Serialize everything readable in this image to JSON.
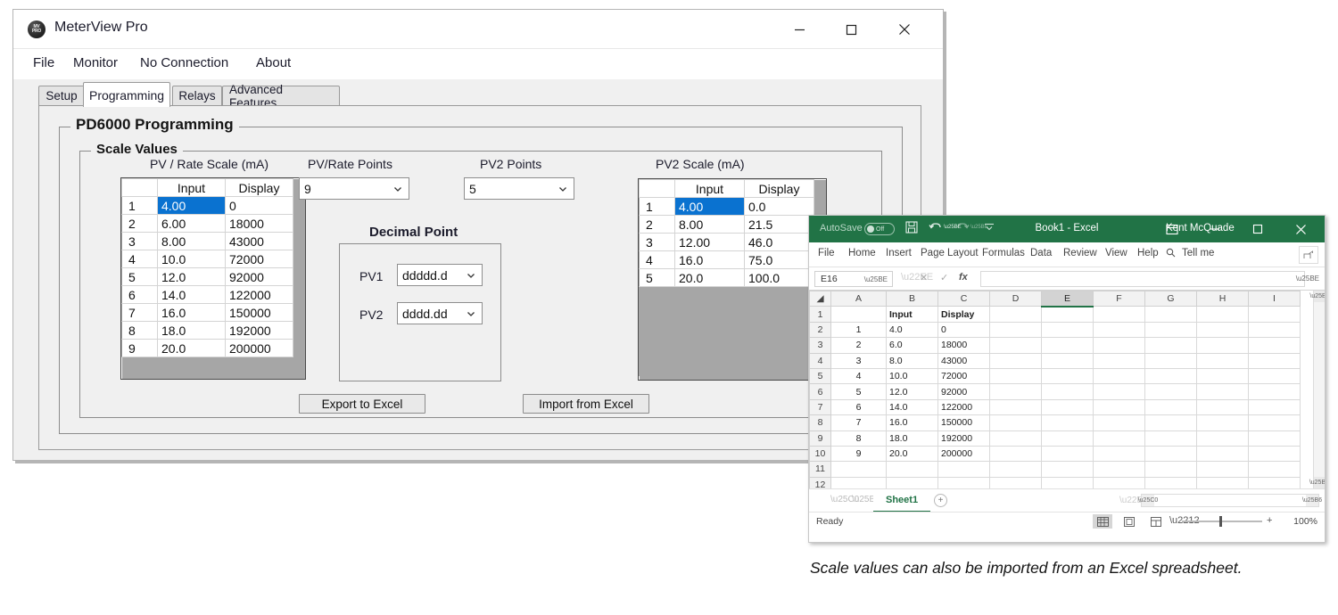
{
  "app_window": {
    "title": "MeterView Pro",
    "icon": "app-logo-icon",
    "window_controls": {
      "minimize": "–",
      "maximize": "☐",
      "close": "✕"
    },
    "menu": [
      {
        "label": "File"
      },
      {
        "label": "Monitor"
      },
      {
        "label": "No Connection"
      },
      {
        "label": "About"
      }
    ],
    "tabs": [
      {
        "label": "Setup",
        "active": false
      },
      {
        "label": "Programming",
        "active": true
      },
      {
        "label": "Relays",
        "active": false
      },
      {
        "label": "Advanced Features",
        "active": false
      }
    ],
    "groups": {
      "outer_title": "PD6000 Programming",
      "inner_title": "Scale Values"
    },
    "pv_rate_scale": {
      "caption": "PV / Rate Scale (mA)",
      "headers": [
        "",
        "Input",
        "Display"
      ],
      "rows": [
        {
          "n": "1",
          "input": "4.00",
          "display": "0",
          "selected": true
        },
        {
          "n": "2",
          "input": "6.00",
          "display": "18000",
          "selected": false
        },
        {
          "n": "3",
          "input": "8.00",
          "display": "43000",
          "selected": false
        },
        {
          "n": "4",
          "input": "10.0",
          "display": "72000",
          "selected": false
        },
        {
          "n": "5",
          "input": "12.0",
          "display": "92000",
          "selected": false
        },
        {
          "n": "6",
          "input": "14.0",
          "display": "122000",
          "selected": false
        },
        {
          "n": "7",
          "input": "16.0",
          "display": "150000",
          "selected": false
        },
        {
          "n": "8",
          "input": "18.0",
          "display": "192000",
          "selected": false
        },
        {
          "n": "9",
          "input": "20.0",
          "display": "200000",
          "selected": false
        }
      ]
    },
    "pv_rate_points": {
      "label": "PV/Rate Points",
      "value": "9"
    },
    "pv2_points": {
      "label": "PV2 Points",
      "value": "5"
    },
    "decimal_point": {
      "title": "Decimal Point",
      "pv1_label": "PV1",
      "pv1_value": "ddddd.d",
      "pv2_label": "PV2",
      "pv2_value": "dddd.dd"
    },
    "pv2_scale": {
      "caption": "PV2 Scale (mA)",
      "headers": [
        "",
        "Input",
        "Display"
      ],
      "rows": [
        {
          "n": "1",
          "input": "4.00",
          "display": "0.0",
          "selected": true
        },
        {
          "n": "2",
          "input": "8.00",
          "display": "21.5",
          "selected": false
        },
        {
          "n": "3",
          "input": "12.00",
          "display": "46.0",
          "selected": false
        },
        {
          "n": "4",
          "input": "16.0",
          "display": "75.0",
          "selected": false
        },
        {
          "n": "5",
          "input": "20.0",
          "display": "100.0",
          "selected": false
        }
      ],
      "empty_rows": 5
    },
    "buttons": {
      "export": "Export to Excel",
      "import": "Import from Excel"
    }
  },
  "excel_window": {
    "autosave_label": "AutoSave",
    "autosave_state": "Off",
    "quick_access": [
      "save-icon",
      "undo-icon",
      "redo-icon",
      "customize-icon"
    ],
    "document_title": "Book1  -  Excel",
    "user": "Kent McQuade",
    "window_controls": {
      "ribbon_display": "⊞",
      "minimize": "–",
      "maximize": "☐",
      "close": "✕"
    },
    "ribbon_tabs": [
      "File",
      "Home",
      "Insert",
      "Page Layout",
      "Formulas",
      "Data",
      "Review",
      "View",
      "Help"
    ],
    "tell_me": "Tell me",
    "share_icon": "share-icon",
    "name_box": "E16",
    "formula_bar": "",
    "formula_icons": {
      "cancel": "✕",
      "enter": "✓",
      "fx": "fx"
    },
    "columns": [
      "A",
      "B",
      "C",
      "D",
      "E",
      "F",
      "G",
      "H",
      "I"
    ],
    "active_column": "E",
    "rows": [
      {
        "r": "1",
        "cells": [
          "",
          "Input",
          "Display",
          "",
          "",
          "",
          "",
          "",
          ""
        ],
        "bold": true
      },
      {
        "r": "2",
        "cells": [
          "1",
          "4.0",
          "0",
          "",
          "",
          "",
          "",
          "",
          ""
        ],
        "bold": false
      },
      {
        "r": "3",
        "cells": [
          "2",
          "6.0",
          "18000",
          "",
          "",
          "",
          "",
          "",
          ""
        ],
        "bold": false
      },
      {
        "r": "4",
        "cells": [
          "3",
          "8.0",
          "43000",
          "",
          "",
          "",
          "",
          "",
          ""
        ],
        "bold": false
      },
      {
        "r": "5",
        "cells": [
          "4",
          "10.0",
          "72000",
          "",
          "",
          "",
          "",
          "",
          ""
        ],
        "bold": false
      },
      {
        "r": "6",
        "cells": [
          "5",
          "12.0",
          "92000",
          "",
          "",
          "",
          "",
          "",
          ""
        ],
        "bold": false
      },
      {
        "r": "7",
        "cells": [
          "6",
          "14.0",
          "122000",
          "",
          "",
          "",
          "",
          "",
          ""
        ],
        "bold": false
      },
      {
        "r": "8",
        "cells": [
          "7",
          "16.0",
          "150000",
          "",
          "",
          "",
          "",
          "",
          ""
        ],
        "bold": false
      },
      {
        "r": "9",
        "cells": [
          "8",
          "18.0",
          "192000",
          "",
          "",
          "",
          "",
          "",
          ""
        ],
        "bold": false
      },
      {
        "r": "10",
        "cells": [
          "9",
          "20.0",
          "200000",
          "",
          "",
          "",
          "",
          "",
          ""
        ],
        "bold": false
      },
      {
        "r": "11",
        "cells": [
          "",
          "",
          "",
          "",
          "",
          "",
          "",
          "",
          ""
        ],
        "bold": false
      },
      {
        "r": "12",
        "cells": [
          "",
          "",
          "",
          "",
          "",
          "",
          "",
          "",
          ""
        ],
        "bold": false
      }
    ],
    "sheet_tab": "Sheet1",
    "add_sheet": "⊕",
    "status": "Ready",
    "zoom": "100%",
    "view_buttons": [
      "normal-view-icon",
      "page-layout-view-icon",
      "page-break-view-icon"
    ]
  },
  "caption": "Scale values can also be imported from an Excel spreadsheet.",
  "colors": {
    "selection_blue": "#0a72d0",
    "excel_green": "#217346",
    "window_gray": "#f0f0f0",
    "grid_gray": "#a6a6a6"
  }
}
